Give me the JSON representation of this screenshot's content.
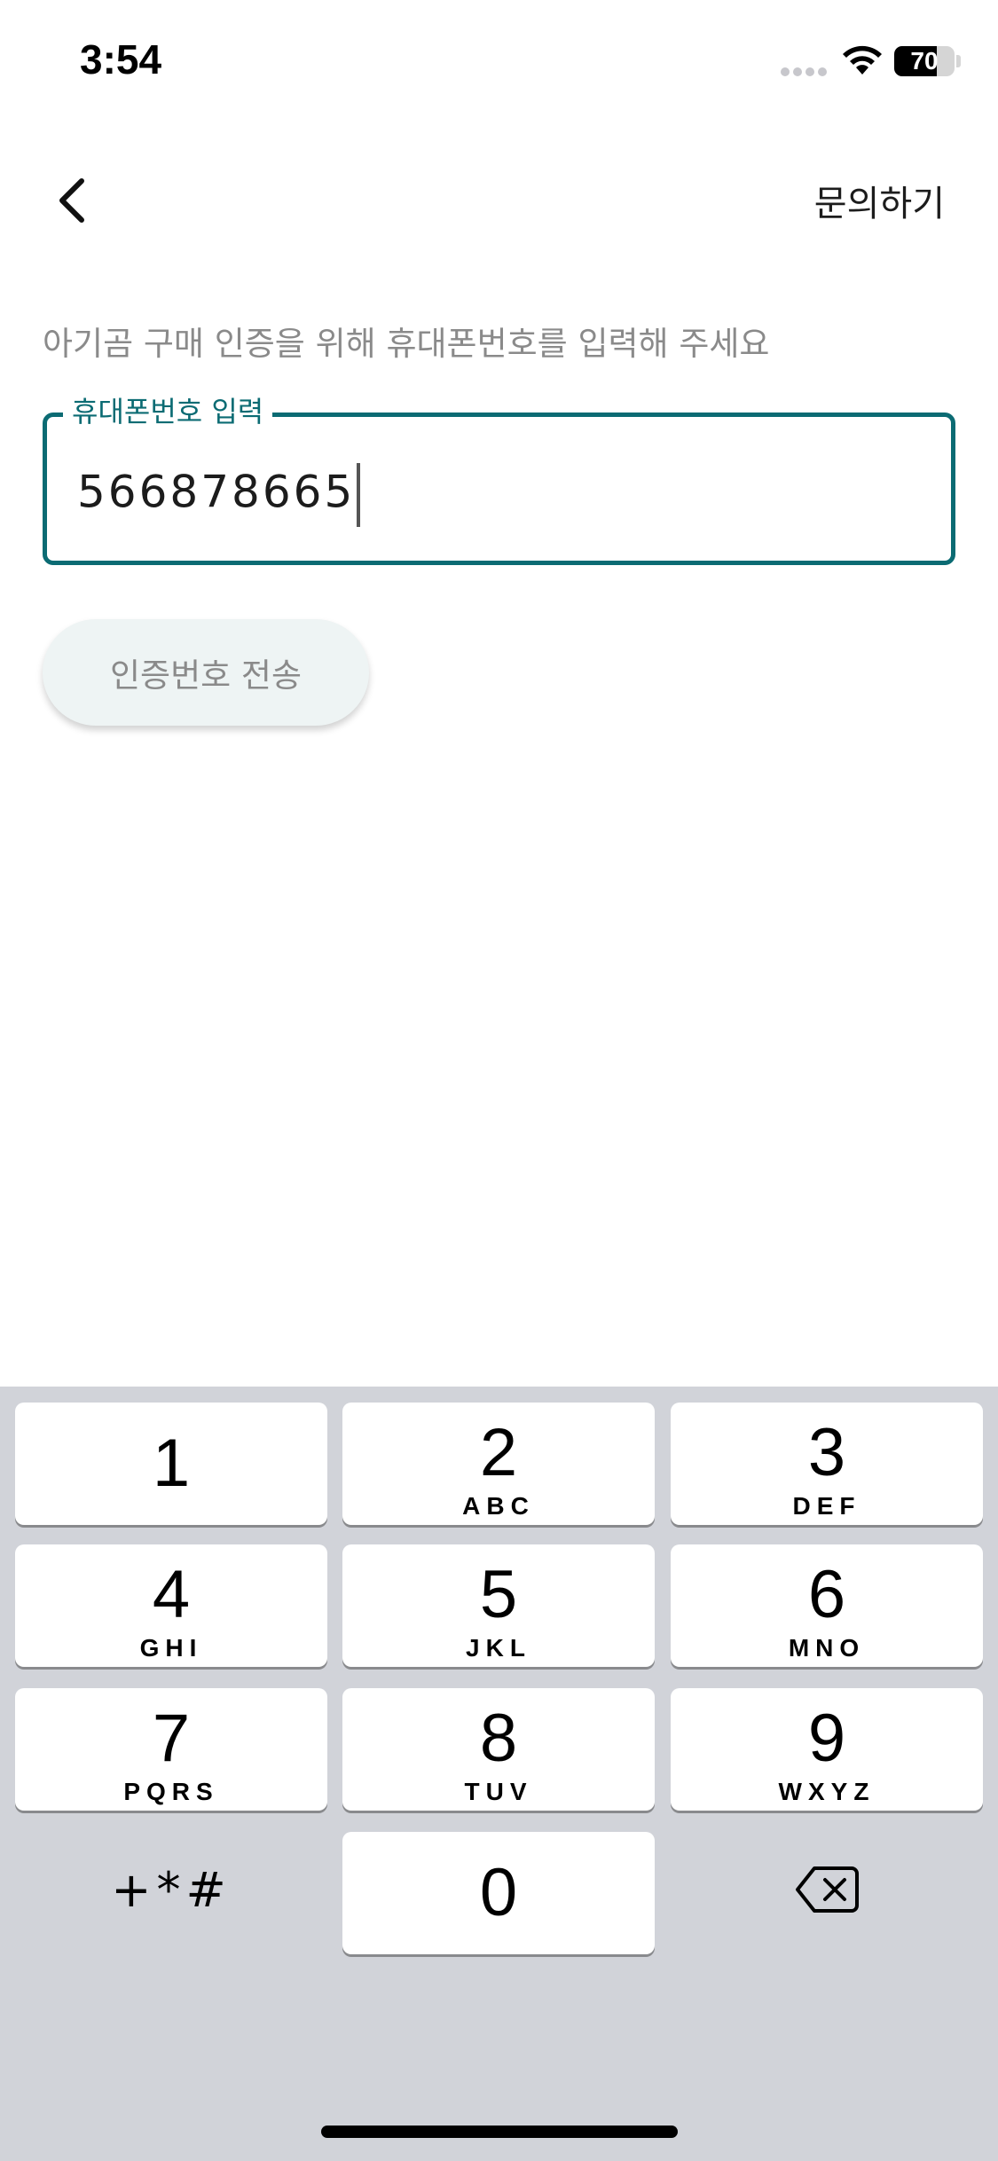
{
  "status_bar": {
    "time": "3:54",
    "battery_text": "70",
    "battery_level": 0.7
  },
  "nav": {
    "inquiry_label": "문의하기"
  },
  "form": {
    "instruction": "아기곰 구매 인증을 위해 휴대폰번호를 입력해 주세요",
    "phone_label": "휴대폰번호 입력",
    "phone_value": "566878665",
    "send_code_label": "인증번호 전송"
  },
  "keypad": {
    "keys": [
      {
        "digit": "1",
        "letters": ""
      },
      {
        "digit": "2",
        "letters": "ABC"
      },
      {
        "digit": "3",
        "letters": "DEF"
      },
      {
        "digit": "4",
        "letters": "GHI"
      },
      {
        "digit": "5",
        "letters": "JKL"
      },
      {
        "digit": "6",
        "letters": "MNO"
      },
      {
        "digit": "7",
        "letters": "PQRS"
      },
      {
        "digit": "8",
        "letters": "TUV"
      },
      {
        "digit": "9",
        "letters": "WXYZ"
      },
      {
        "digit": "0",
        "letters": ""
      }
    ],
    "symbols_label": "+*#"
  },
  "colors": {
    "accent": "#0b6b73",
    "keypad_background": "#d1d3d9"
  }
}
